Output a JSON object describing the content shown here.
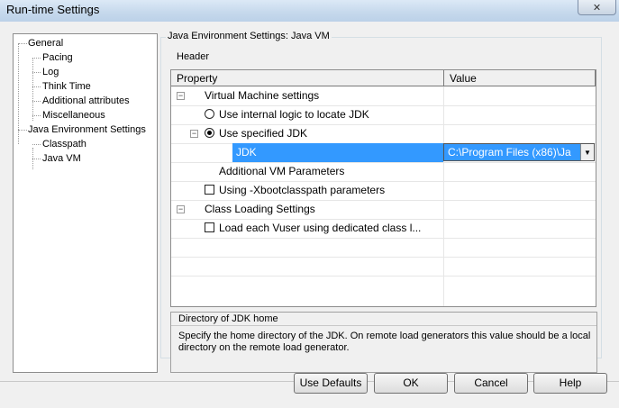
{
  "window": {
    "title": "Run-time Settings",
    "close_glyph": "✕"
  },
  "tree": {
    "items": [
      {
        "label": "General"
      },
      {
        "label": "Pacing"
      },
      {
        "label": "Log"
      },
      {
        "label": "Think Time"
      },
      {
        "label": "Additional attributes"
      },
      {
        "label": "Miscellaneous"
      },
      {
        "label": "Java Environment Settings"
      },
      {
        "label": "Classpath"
      },
      {
        "label": "Java VM"
      }
    ]
  },
  "panel": {
    "group_title": "Java Environment Settings: Java VM",
    "header_label": "Header"
  },
  "grid": {
    "columns": [
      "Property",
      "Value"
    ],
    "rows": [
      {
        "label": "Virtual Machine settings",
        "control": "expander",
        "expander_glyph": "−"
      },
      {
        "label": "Use internal logic to locate JDK",
        "control": "radio",
        "selected": false
      },
      {
        "label": "Use specified JDK",
        "control": "radio",
        "selected": true,
        "expander_glyph": "−"
      },
      {
        "label": "JDK",
        "control": "none",
        "value": "C:\\Program Files (x86)\\Ja",
        "highlighted": true
      },
      {
        "label": "Additional VM Parameters",
        "control": "none"
      },
      {
        "label": "Using -Xbootclasspath parameters",
        "control": "checkbox",
        "checked": false
      },
      {
        "label": "Class Loading Settings",
        "control": "expander",
        "expander_glyph": "−"
      },
      {
        "label": "Load each Vuser using dedicated class l...",
        "control": "checkbox",
        "checked": false
      }
    ],
    "dropdown_glyph": "▼"
  },
  "description": {
    "title": "Directory of JDK home",
    "text": "Specify the  home directory of the JDK. On remote load generators this value should be a local directory on the remote load generator."
  },
  "buttons": {
    "use_defaults": "Use Defaults",
    "ok": "OK",
    "cancel": "Cancel",
    "help": "Help"
  },
  "colors": {
    "selection": "#3399ff"
  }
}
